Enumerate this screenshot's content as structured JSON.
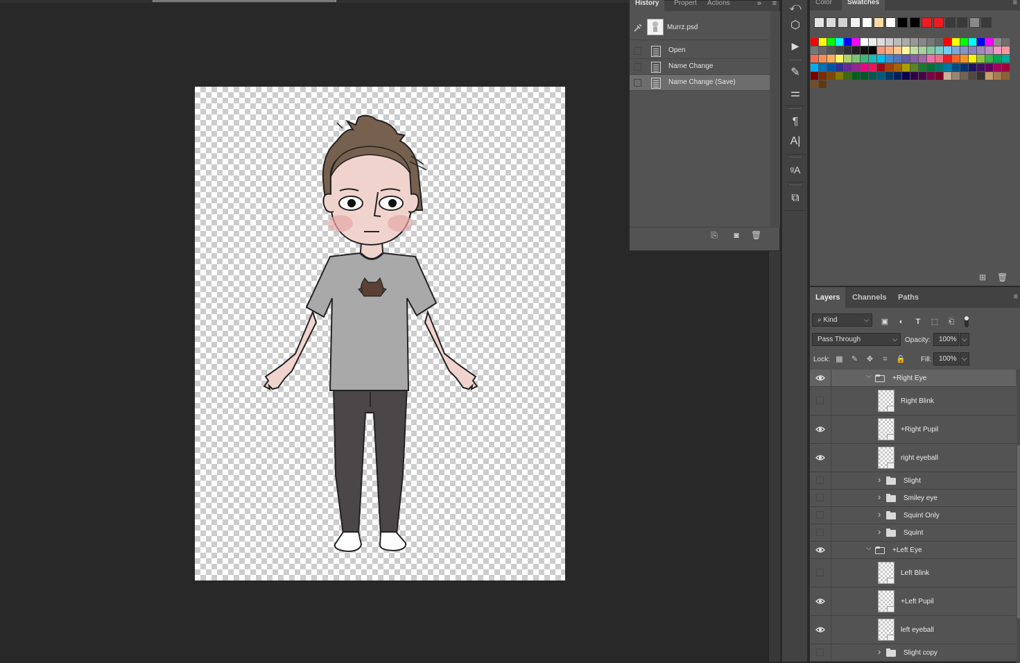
{
  "history_panel": {
    "tabs": [
      "History",
      "Propert",
      "Actions"
    ],
    "document": "Murrz.psd",
    "states": [
      {
        "label": "Open",
        "selected": false
      },
      {
        "label": "Name Change",
        "selected": false
      },
      {
        "label": "Name Change (Save)",
        "selected": true
      }
    ],
    "footer_icons": [
      "new-document-from-state-icon",
      "camera-snapshot-icon",
      "trash-icon"
    ]
  },
  "color_panel": {
    "tabs": [
      "Color",
      "Swatches"
    ],
    "recent_swatches": [
      "#e5e5e5",
      "#dcdcdc",
      "#d2d2d2",
      "#f2f2f2",
      "#ffffff",
      "#f8dca4",
      "#ffffff",
      "#000000",
      "#000000",
      "#ec1c24",
      "#ec1c24",
      "#3a3a3a",
      "#3a3a3a",
      "#8a8a8a",
      "#3a3a3a"
    ],
    "footer_icons": [
      "new-swatch-icon",
      "trash-icon"
    ]
  },
  "tools": [
    "history-brush-icon",
    "3d-icon",
    "play-icon",
    "brush-presets-icon",
    "adjustments-icon",
    "paragraph-icon",
    "character-icon",
    "glyphs-icon",
    "clone-source-icon"
  ],
  "layers_panel": {
    "tabs": [
      "Layers",
      "Channels",
      "Paths"
    ],
    "filter_label": "Kind",
    "blend_mode": "Pass Through",
    "opacity_label": "Opacity:",
    "opacity": "100%",
    "lock_label": "Lock:",
    "fill_label": "Fill:",
    "fill": "100%",
    "layers": [
      {
        "name": "+Right Eye",
        "type": "group-open",
        "visible": true,
        "selected": true
      },
      {
        "name": "Right Blink",
        "type": "layer",
        "visible": false
      },
      {
        "name": "+Right Pupil",
        "type": "layer",
        "visible": true
      },
      {
        "name": "right eyeball",
        "type": "layer",
        "visible": true
      },
      {
        "name": "Slight",
        "type": "group",
        "visible": false
      },
      {
        "name": "Smiley eye",
        "type": "group",
        "visible": false
      },
      {
        "name": "Squint Only",
        "type": "group",
        "visible": false
      },
      {
        "name": "Squint",
        "type": "group",
        "visible": false
      },
      {
        "name": "+Left Eye",
        "type": "group-open",
        "visible": true
      },
      {
        "name": "Left Blink",
        "type": "layer",
        "visible": false
      },
      {
        "name": "+Left Pupil",
        "type": "layer",
        "visible": true
      },
      {
        "name": "left eyeball",
        "type": "layer",
        "visible": true
      },
      {
        "name": "Slight copy",
        "type": "group",
        "visible": false
      }
    ]
  },
  "colors": {
    "hair": "#76604e",
    "skin": "#f1d3ce",
    "shirt": "#a9a9a9",
    "pants": "#4b4647",
    "cat_badge": "#5a4035"
  }
}
